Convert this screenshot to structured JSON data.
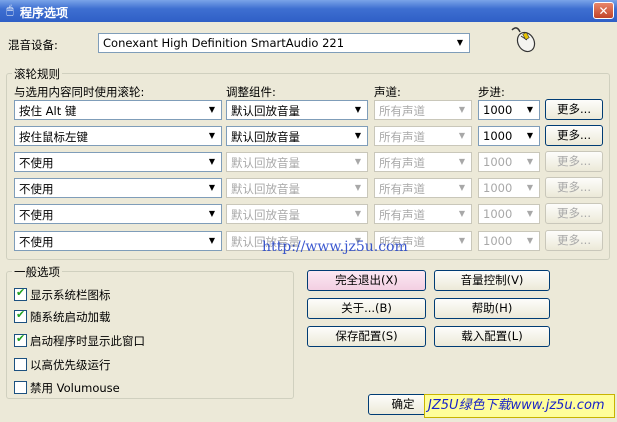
{
  "window": {
    "title": "程序选项",
    "close_label": "✕"
  },
  "mixer": {
    "label": "混音设备:",
    "value": "Conexant High Definition SmartAudio 221"
  },
  "wheel_rules": {
    "group_label": "滚轮规则",
    "headers": {
      "modifier": "与选用内容同时使用滚轮:",
      "component": "调整组件:",
      "channel": "声道:",
      "step": "步进:"
    },
    "rows": [
      {
        "modifier": "按住 Alt 键",
        "component": "默认回放音量",
        "channel": "所有声道",
        "step": "1000",
        "more": "更多...",
        "enabled": true
      },
      {
        "modifier": "按住鼠标左键",
        "component": "默认回放音量",
        "channel": "所有声道",
        "step": "1000",
        "more": "更多...",
        "enabled": true
      },
      {
        "modifier": "不使用",
        "component": "默认回放音量",
        "channel": "所有声道",
        "step": "1000",
        "more": "更多...",
        "enabled": false
      },
      {
        "modifier": "不使用",
        "component": "默认回放音量",
        "channel": "所有声道",
        "step": "1000",
        "more": "更多...",
        "enabled": false
      },
      {
        "modifier": "不使用",
        "component": "默认回放音量",
        "channel": "所有声道",
        "step": "1000",
        "more": "更多...",
        "enabled": false
      },
      {
        "modifier": "不使用",
        "component": "默认回放音量",
        "channel": "所有声道",
        "step": "1000",
        "more": "更多...",
        "enabled": false
      }
    ]
  },
  "general": {
    "group_label": "一般选项",
    "options": [
      {
        "label": "显示系统栏图标",
        "checked": true
      },
      {
        "label": "随系统启动加载",
        "checked": true
      },
      {
        "label": "启动程序时显示此窗口",
        "checked": true
      },
      {
        "label": "以高优先级运行",
        "checked": false
      },
      {
        "label": "禁用 Volumouse",
        "checked": false
      }
    ]
  },
  "buttons": {
    "exit": "完全退出(X)",
    "volume": "音量控制(V)",
    "about": "关于...(B)",
    "help": "帮助(H)",
    "save": "保存配置(S)",
    "load": "载入配置(L)",
    "ok": "确定"
  },
  "watermark": "http://www.jz5u.com",
  "banner": "JZ5U绿色下载www.jz5u.com",
  "icons": {
    "title": "mouse-icon",
    "mixer": "mouse-device-icon",
    "dropdown": "chevron-down-icon",
    "check": "checkmark-icon"
  }
}
